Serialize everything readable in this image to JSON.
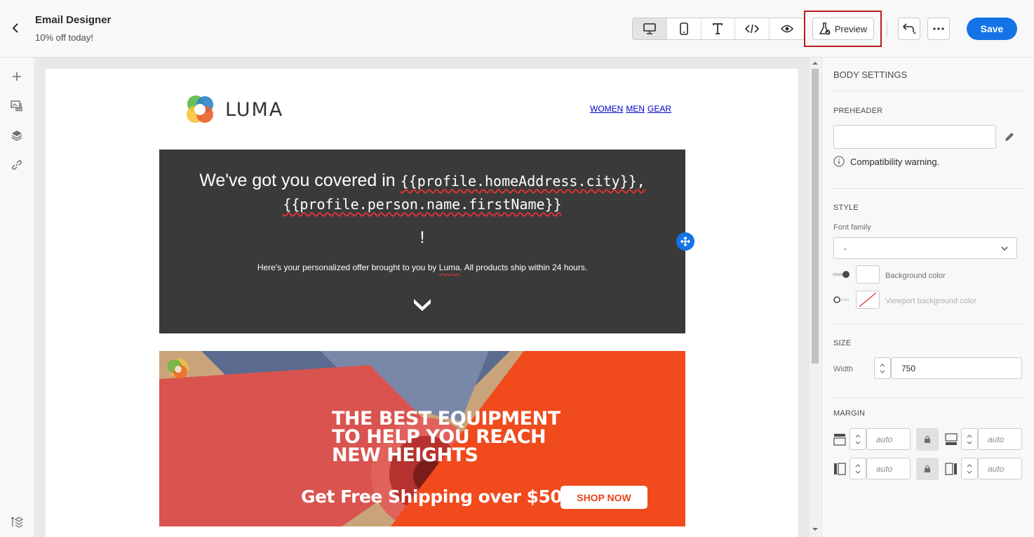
{
  "header": {
    "title": "Email Designer",
    "subtitle": "10% off today!",
    "preview_label": "Preview",
    "save_label": "Save",
    "view_modes": [
      "desktop-icon",
      "mobile-icon",
      "text-icon",
      "code-icon",
      "eye-icon"
    ],
    "active_view": "desktop"
  },
  "left_rail": {
    "icons": [
      "plus-icon",
      "assets-icon",
      "layers-icon",
      "link-icon",
      "history-icon"
    ]
  },
  "email": {
    "logo_text": "LUMA",
    "nav": [
      "WOMEN",
      "MEN",
      "GEAR"
    ],
    "hero": {
      "line1_text": "We've got you covered in ",
      "line1_code": "{{profile.homeAddress.city}},",
      "line2_code": "{{profile.person.name.firstName}}",
      "exclamation": "!",
      "sub_before": "Here's your personalized offer brought to you by ",
      "sub_brand": "Luma",
      "sub_after": ". All products ship within 24 hours."
    },
    "banner": {
      "headline_1": "THE BEST EQUIPMENT",
      "headline_2": "TO HELP YOU REACH",
      "headline_3": "NEW HEIGHTS",
      "shipping": "Get Free Shipping over $50",
      "cta": "SHOP NOW"
    }
  },
  "panel": {
    "title": "BODY SETTINGS",
    "preheader_label": "PREHEADER",
    "preheader_value": "",
    "compat_warning": "Compatibility warning.",
    "style_label": "STYLE",
    "font_family_label": "Font family",
    "font_family_value": "-",
    "bg_color_label": "Background color",
    "viewport_bg_label": "Viewport background color",
    "size_label": "SIZE",
    "width_label": "Width",
    "width_value": "750",
    "margin_label": "MARGIN",
    "margin_values": [
      "auto",
      "auto",
      "auto",
      "auto"
    ],
    "colors": {
      "accent": "#1473e6",
      "hero_bg": "#3a3a3a",
      "banner_orange": "#f04a1d",
      "highlight": "#b71c1c"
    }
  }
}
